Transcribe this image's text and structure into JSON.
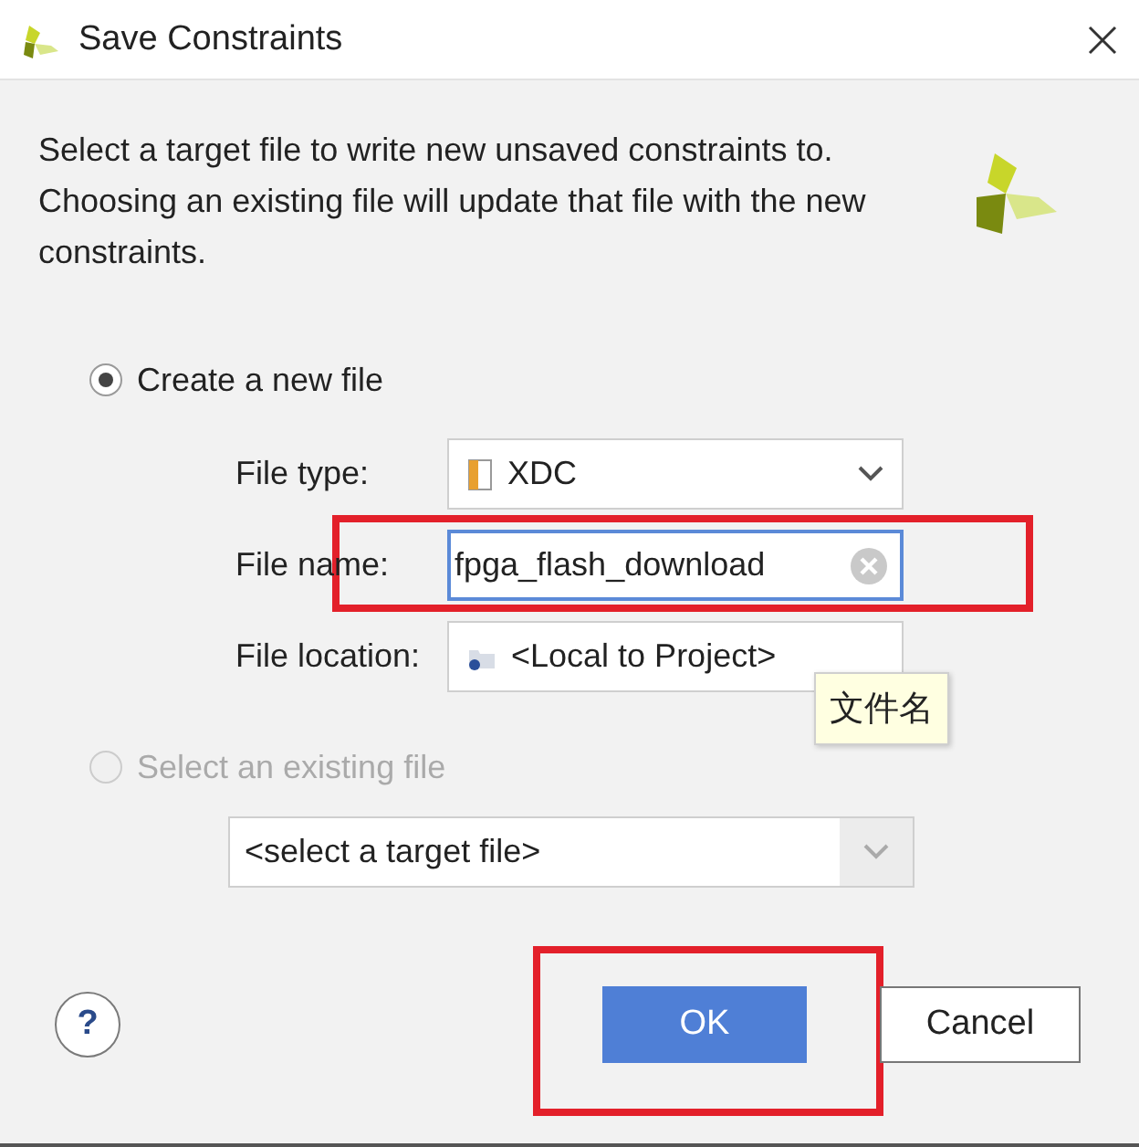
{
  "window": {
    "title": "Save Constraints"
  },
  "description": "Select a target file to write new unsaved constraints to. Choosing an existing file will update that file with the new constraints.",
  "options": [
    {
      "label": "Create a new file",
      "selected": true,
      "disabled": false,
      "fields": [
        {
          "kind": "select",
          "label": "File type:",
          "value": "XDC",
          "highlighted": false
        },
        {
          "kind": "input",
          "label": "File name:",
          "value": "fpga_flash_download",
          "focused": true,
          "highlighted": true
        },
        {
          "kind": "path",
          "label": "File location:",
          "value": "<Local to Project>",
          "highlighted": false
        }
      ]
    },
    {
      "label": "Select an existing file",
      "selected": false,
      "disabled": true,
      "combo": {
        "value": "<select a target file>"
      }
    }
  ],
  "tooltip": {
    "text": "文件名"
  },
  "help": "?",
  "buttons": [
    {
      "label": "OK",
      "kind": "primary",
      "highlighted": true
    },
    {
      "label": "Cancel",
      "kind": "secondary",
      "highlighted": false
    }
  ]
}
